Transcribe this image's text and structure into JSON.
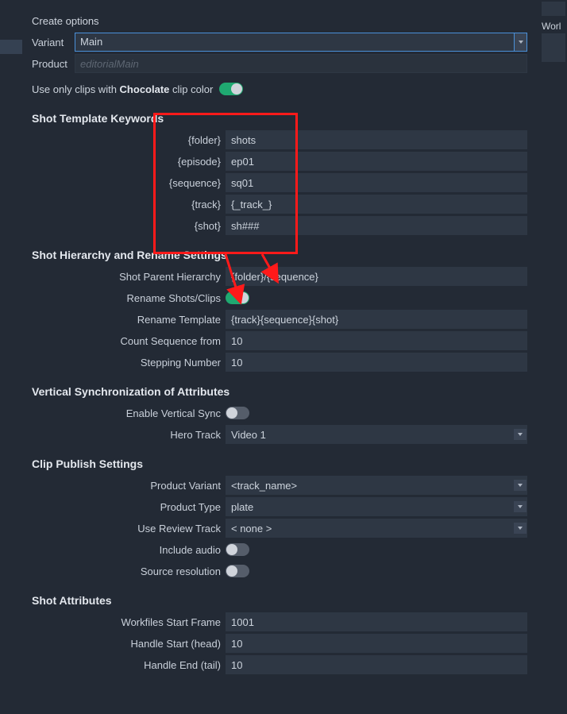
{
  "header": {
    "create_options": "Create options",
    "variant_label": "Variant",
    "variant_value": "Main",
    "product_label": "Product",
    "product_placeholder": "editorialMain",
    "use_clips_prefix": "Use only clips with ",
    "use_clips_bold": "Chocolate",
    "use_clips_suffix": " clip color"
  },
  "template_keywords": {
    "title": "Shot Template Keywords",
    "rows": [
      {
        "label": "{folder}",
        "value": "shots"
      },
      {
        "label": "{episode}",
        "value": "ep01"
      },
      {
        "label": "{sequence}",
        "value": "sq01"
      },
      {
        "label": "{track}",
        "value": "{_track_}"
      },
      {
        "label": "{shot}",
        "value": "sh###"
      }
    ]
  },
  "hierarchy": {
    "title": "Shot Hierarchy and Rename Settings",
    "parent_label": "Shot Parent Hierarchy",
    "parent_value": "{folder}/{sequence}",
    "rename_clips_label": "Rename Shots/Clips",
    "rename_template_label": "Rename Template",
    "rename_template_value": "{track}{sequence}{shot}",
    "count_from_label": "Count Sequence from",
    "count_from_value": "10",
    "stepping_label": "Stepping Number",
    "stepping_value": "10"
  },
  "vsync": {
    "title": "Vertical Synchronization of Attributes",
    "enable_label": "Enable Vertical Sync",
    "hero_label": "Hero Track",
    "hero_value": "Video 1"
  },
  "publish": {
    "title": "Clip Publish Settings",
    "product_variant_label": "Product Variant",
    "product_variant_value": "<track_name>",
    "product_type_label": "Product Type",
    "product_type_value": "plate",
    "review_track_label": "Use Review Track",
    "review_track_value": "< none >",
    "include_audio_label": "Include audio",
    "source_res_label": "Source resolution"
  },
  "shot_attributes": {
    "title": "Shot Attributes",
    "workfiles_label": "Workfiles Start Frame",
    "workfiles_value": "1001",
    "handle_start_label": "Handle Start (head)",
    "handle_start_value": "10",
    "handle_end_label": "Handle End (tail)",
    "handle_end_value": "10"
  },
  "side": {
    "work_label": "Worl"
  }
}
